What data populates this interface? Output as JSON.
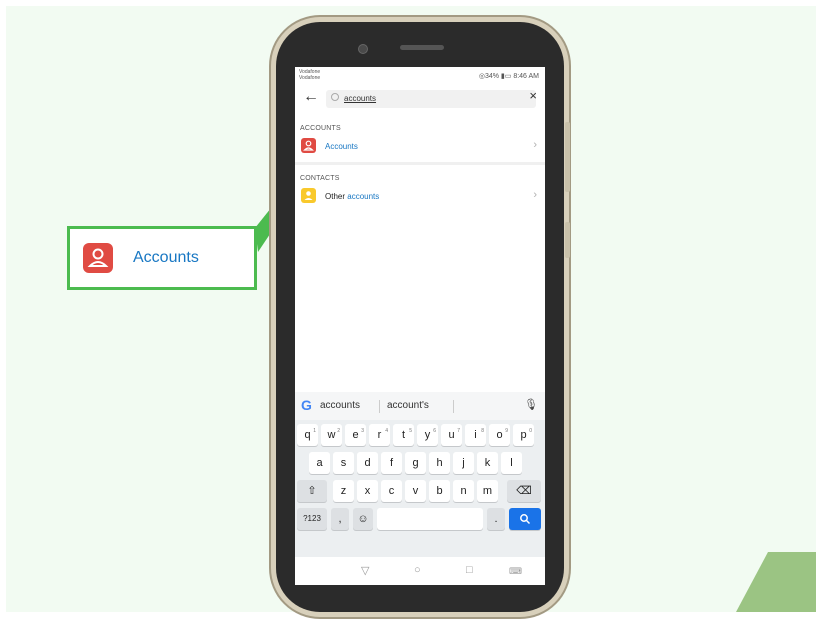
{
  "statusbar": {
    "carrier": "Vodafone\nVodafone",
    "right": "◎34% ▮▭ 8:46 AM"
  },
  "search": {
    "query": "accounts"
  },
  "sections": [
    {
      "header": "ACCOUNTS",
      "items": [
        {
          "label": "Accounts",
          "icon": "accounts-icon",
          "color": "#e04b43"
        }
      ]
    },
    {
      "header": "CONTACTS",
      "items": [
        {
          "label_prefix": "Other",
          "label_match": "accounts",
          "icon": "contacts-icon",
          "color": "#f9c92c"
        }
      ]
    }
  ],
  "keyboard": {
    "suggestions": [
      "accounts",
      "account's"
    ],
    "row1": [
      "q",
      "w",
      "e",
      "r",
      "t",
      "y",
      "u",
      "i",
      "o",
      "p"
    ],
    "row1_sup": [
      "1",
      "2",
      "3",
      "4",
      "5",
      "6",
      "7",
      "8",
      "9",
      "0"
    ],
    "row2": [
      "a",
      "s",
      "d",
      "f",
      "g",
      "h",
      "j",
      "k",
      "l"
    ],
    "row3": [
      "z",
      "x",
      "c",
      "v",
      "b",
      "n",
      "m"
    ],
    "symbols_label": "?123",
    "comma": ",",
    "period": "."
  },
  "callout": {
    "label": "Accounts"
  },
  "colors": {
    "accent_blue": "#1877c3",
    "callout_border": "#4cbb4f",
    "accounts_red": "#e04b43",
    "contacts_yellow": "#f9c92c"
  }
}
